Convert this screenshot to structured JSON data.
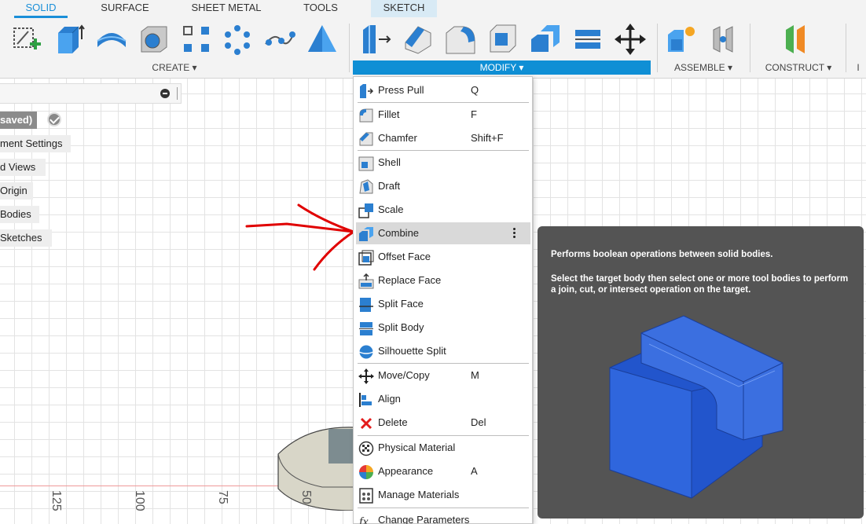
{
  "tabs": [
    "SOLID",
    "SURFACE",
    "SHEET METAL",
    "TOOLS",
    "SKETCH"
  ],
  "groups": {
    "create": "CREATE ▾",
    "modify": "MODIFY ▾",
    "assemble": "ASSEMBLE ▾",
    "construct": "CONSTRUCT ▾",
    "insert": "I"
  },
  "browser": {
    "items": [
      "saved)",
      "ment Settings",
      "d Views",
      "Origin",
      "Bodies",
      "Sketches"
    ]
  },
  "menu": {
    "items": [
      {
        "label": "Press Pull",
        "key": "Q",
        "icon": "press-pull-icon"
      },
      {
        "label": "Fillet",
        "key": "F",
        "icon": "fillet-icon"
      },
      {
        "label": "Chamfer",
        "key": "Shift+F",
        "icon": "chamfer-icon"
      },
      {
        "label": "Shell",
        "key": "",
        "icon": "shell-icon"
      },
      {
        "label": "Draft",
        "key": "",
        "icon": "draft-icon"
      },
      {
        "label": "Scale",
        "key": "",
        "icon": "scale-icon"
      },
      {
        "label": "Combine",
        "key": "",
        "icon": "combine-icon"
      },
      {
        "label": "Offset Face",
        "key": "",
        "icon": "offset-face-icon"
      },
      {
        "label": "Replace Face",
        "key": "",
        "icon": "replace-face-icon"
      },
      {
        "label": "Split Face",
        "key": "",
        "icon": "split-face-icon"
      },
      {
        "label": "Split Body",
        "key": "",
        "icon": "split-body-icon"
      },
      {
        "label": "Silhouette Split",
        "key": "",
        "icon": "silhouette-split-icon"
      },
      {
        "label": "Move/Copy",
        "key": "M",
        "icon": "move-copy-icon"
      },
      {
        "label": "Align",
        "key": "",
        "icon": "align-icon"
      },
      {
        "label": "Delete",
        "key": "Del",
        "icon": "delete-icon"
      },
      {
        "label": "Physical Material",
        "key": "",
        "icon": "physical-material-icon"
      },
      {
        "label": "Appearance",
        "key": "A",
        "icon": "appearance-icon"
      },
      {
        "label": "Manage Materials",
        "key": "",
        "icon": "manage-materials-icon"
      },
      {
        "label": "Change Parameters",
        "key": "",
        "icon": "change-parameters-icon"
      }
    ]
  },
  "tooltip": {
    "line1": "Performs boolean operations between solid bodies.",
    "line2": "Select the target body then select one or more tool bodies to perform a join, cut, or intersect operation on the target."
  },
  "ruler": [
    "125",
    "100",
    "75",
    "50"
  ],
  "colors": {
    "accent": "#0f8fd5",
    "tab_active": "#1a8fd8",
    "annotation": "#e00000",
    "tooltip_bg": "#545454"
  }
}
